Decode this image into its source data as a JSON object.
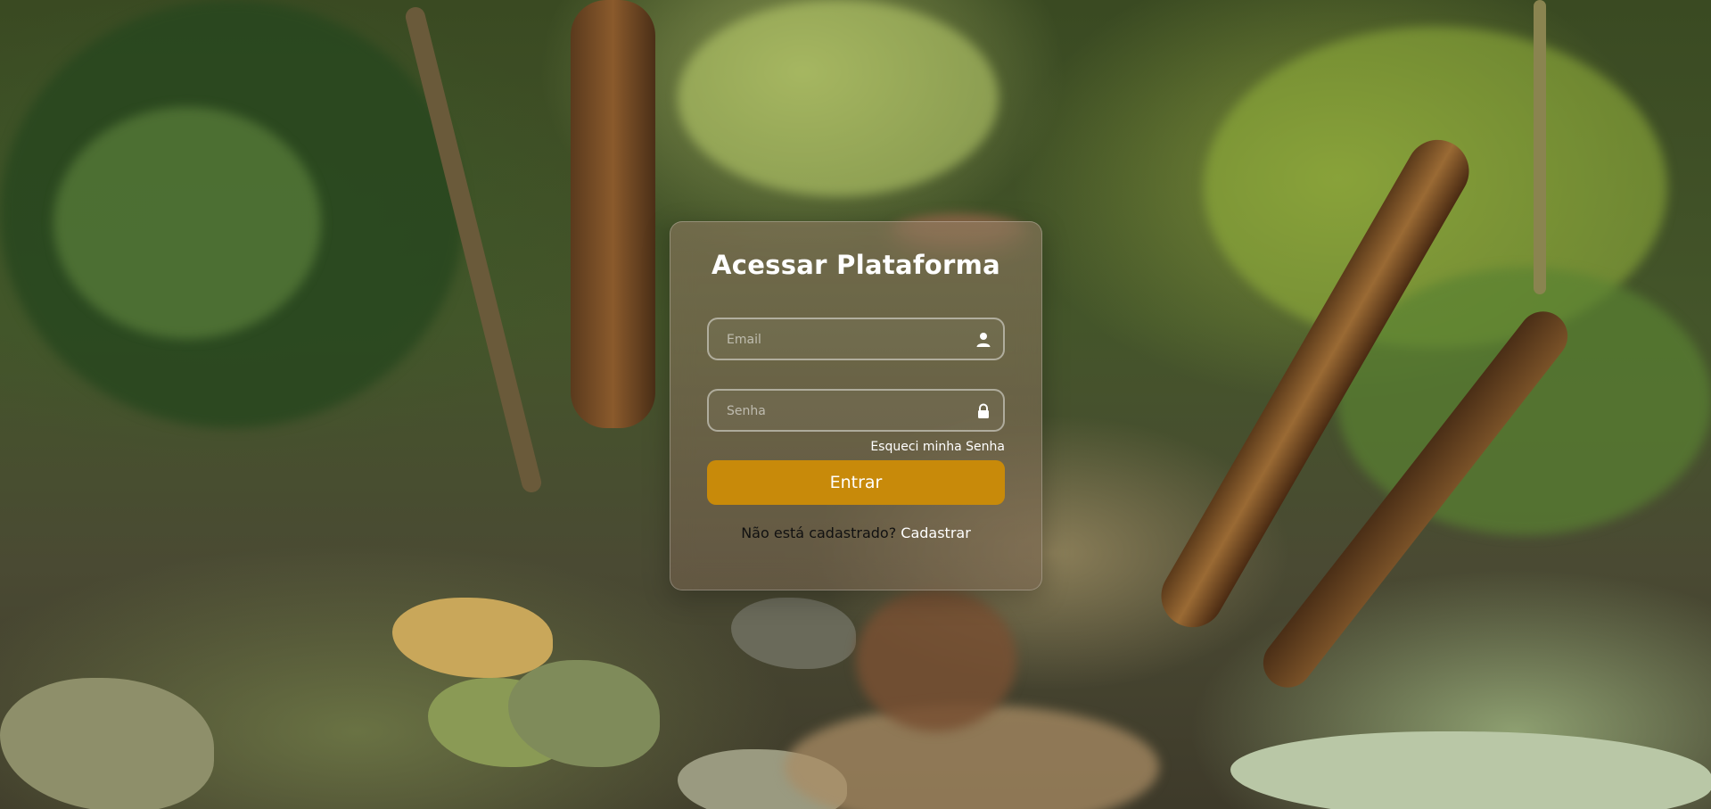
{
  "login": {
    "title": "Acessar Plataforma",
    "email_placeholder": "Email",
    "password_placeholder": "Senha",
    "email_icon": "user-icon",
    "password_icon": "lock-icon",
    "forgot_label": "Esqueci minha Senha",
    "submit_label": "Entrar",
    "signup_prompt": "Não está cadastrado?",
    "signup_link": "Cadastrar"
  },
  "colors": {
    "primary_button": "#c88a0a",
    "card_text": "#ffffff"
  }
}
